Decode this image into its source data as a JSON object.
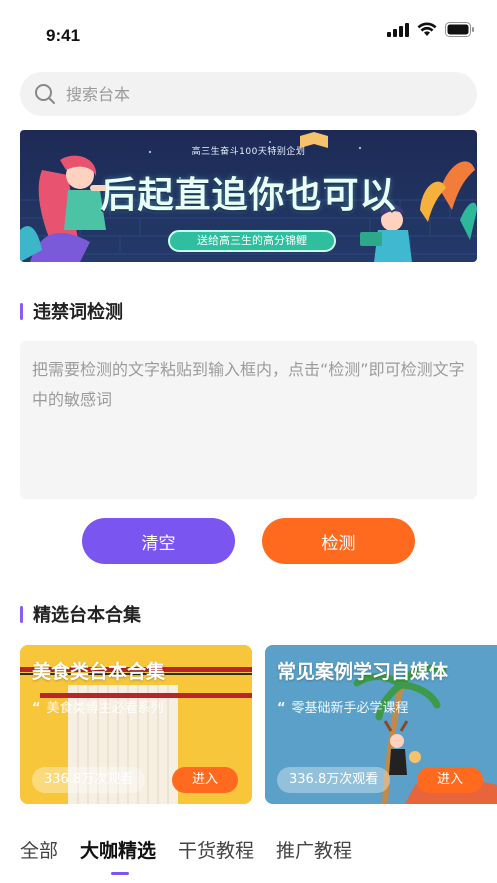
{
  "status_bar": {
    "time": "9:41"
  },
  "search": {
    "placeholder": "搜索台本"
  },
  "banner": {
    "subtitle": "高三生奋斗100天特别企划",
    "title": "后起直追你也可以",
    "ribbon": "送给高三生的高分锦鲤"
  },
  "sensitive_check": {
    "title": "违禁词检测",
    "placeholder": "把需要检测的文字粘贴到输入框内，点击“检测”即可检测文字中的敏感词",
    "clear_label": "清空",
    "check_label": "检测"
  },
  "collections": {
    "title": "精选台本合集",
    "cards": [
      {
        "title": "美食类台本合集",
        "subtitle": "美食类博主必看系列",
        "views": "336.8万次观看",
        "enter": "进入"
      },
      {
        "title": "常见案例学习自媒体",
        "subtitle": "零基础新手必学课程",
        "views": "336.8万次观看",
        "enter": "进入"
      }
    ]
  },
  "tabs": [
    {
      "label": "全部"
    },
    {
      "label": "大咖精选"
    },
    {
      "label": "干货教程"
    },
    {
      "label": "推广教程"
    }
  ],
  "colors": {
    "accent_purple": "#7b55f0",
    "accent_orange": "#ff6a1f",
    "section_bar": "#8a5cf6"
  }
}
